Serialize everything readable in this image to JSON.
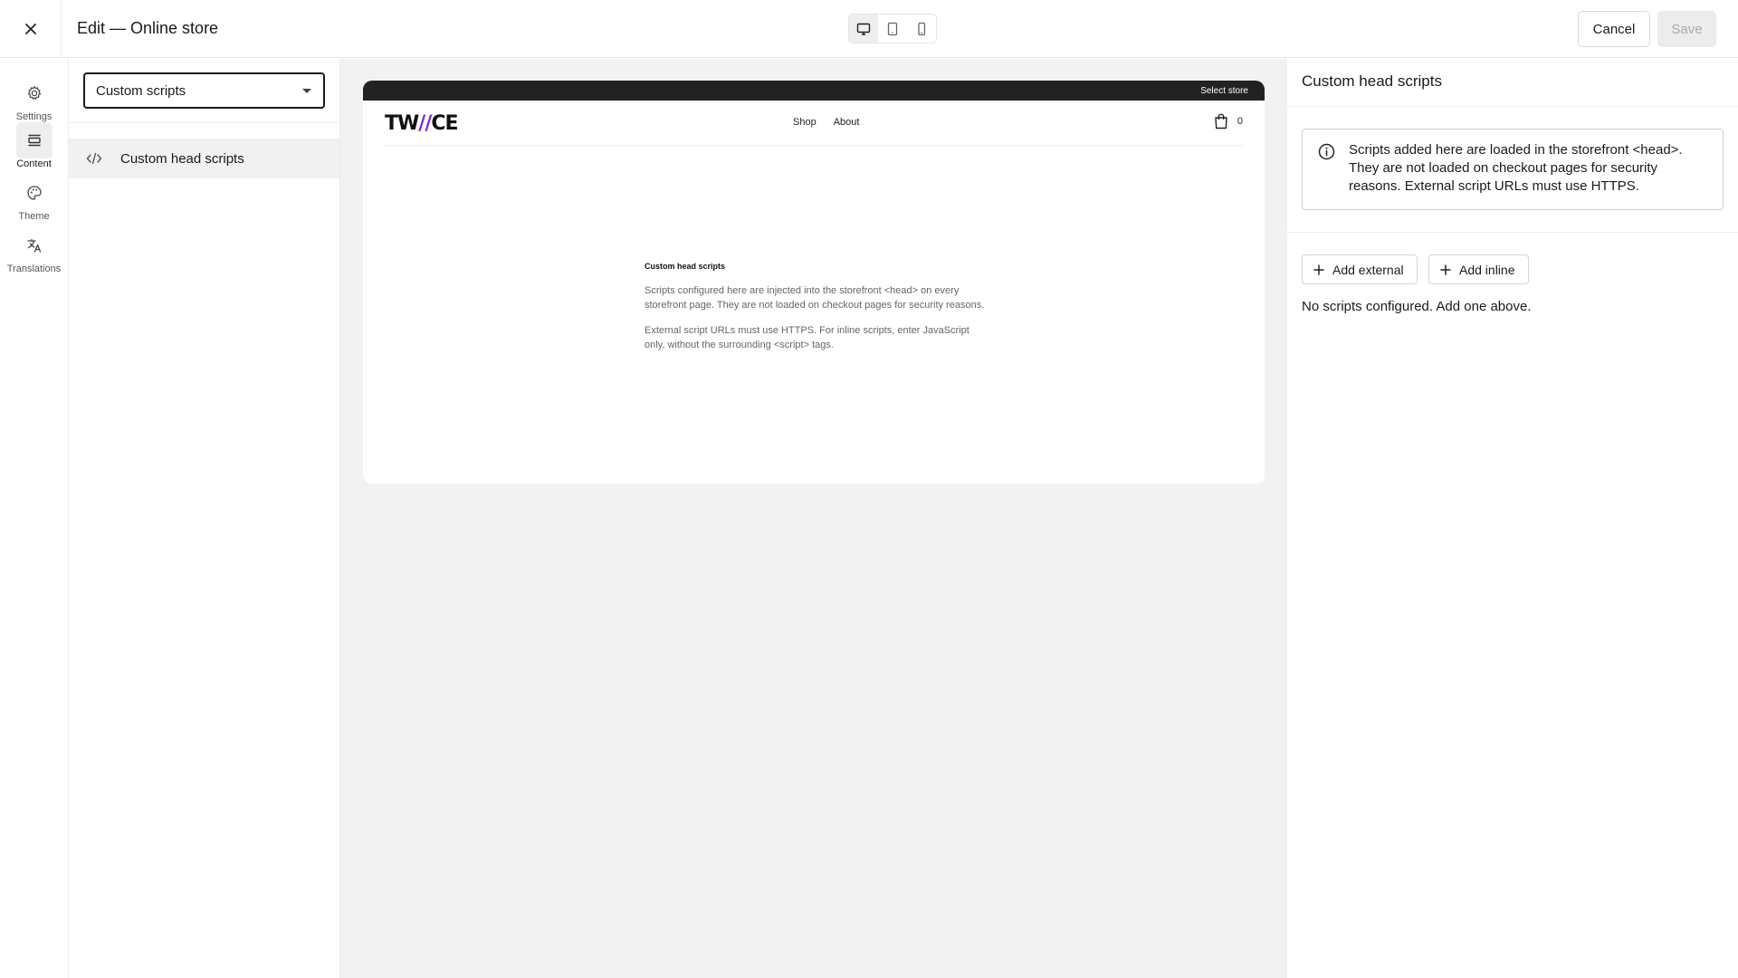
{
  "header": {
    "title": "Edit — Online store",
    "close_icon": "close-icon",
    "devices": [
      {
        "name": "desktop-icon",
        "active": true
      },
      {
        "name": "tablet-icon",
        "active": false
      },
      {
        "name": "mobile-icon",
        "active": false
      }
    ],
    "cancel_label": "Cancel",
    "save_label": "Save"
  },
  "rail": {
    "items": [
      {
        "label": "Settings",
        "icon": "gear-icon",
        "active": false
      },
      {
        "label": "Content",
        "icon": "content-icon",
        "active": true
      },
      {
        "label": "Theme",
        "icon": "palette-icon",
        "active": false
      },
      {
        "label": "Translations",
        "icon": "translate-icon",
        "active": false
      }
    ]
  },
  "sidebar": {
    "select_value": "Custom scripts",
    "items": [
      {
        "label": "Custom head scripts",
        "icon": "code-icon"
      }
    ]
  },
  "preview": {
    "announcement": "Select store",
    "logo_left": "TW",
    "logo_accent": "//",
    "logo_right": "CE",
    "nav_links": [
      "Shop",
      "About"
    ],
    "cart_count": "0",
    "content_title": "Custom head scripts",
    "content_p1": "Scripts configured here are injected into the storefront <head> on every storefront page. They are not loaded on checkout pages for security reasons.",
    "content_p2": "External script URLs must use HTTPS. For inline scripts, enter JavaScript only, without the surrounding <script> tags."
  },
  "panel": {
    "title": "Custom head scripts",
    "info_text": "Scripts added here are loaded in the storefront <head>. They are not loaded on checkout pages for security reasons. External script URLs must use HTTPS.",
    "add_external_label": "Add external",
    "add_inline_label": "Add inline",
    "empty_message": "No scripts configured. Add one above."
  },
  "colors": {
    "accent": "#7a2ad6",
    "canvas_bg": "#f2f2f2",
    "announce_bg": "#222222"
  }
}
